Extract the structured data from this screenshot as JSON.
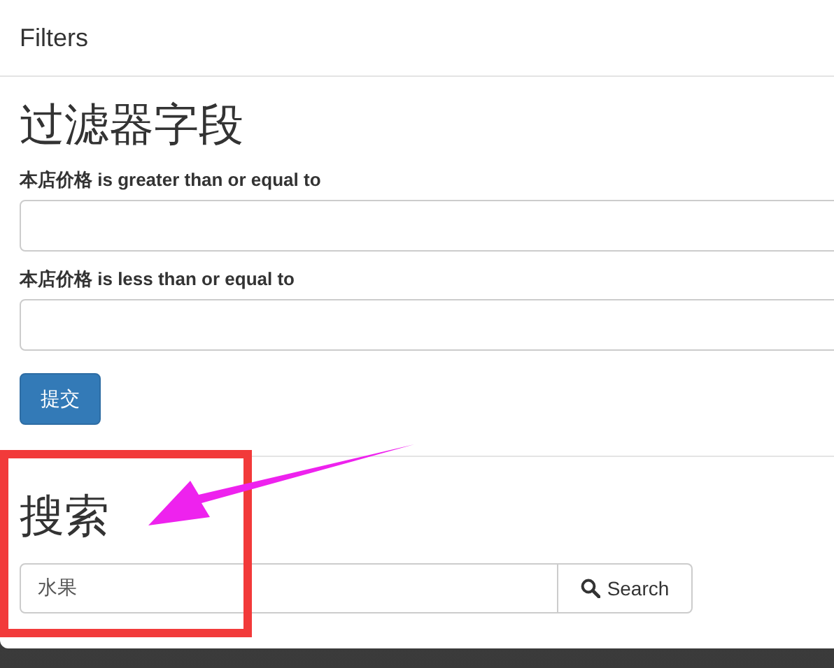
{
  "panel": {
    "title": "Filters"
  },
  "filter_section": {
    "heading": "过滤器字段",
    "fields": [
      {
        "label": "本店价格 is greater than or equal to"
      },
      {
        "label": "本店价格 is less than or equal to"
      }
    ],
    "submit_button": "提交"
  },
  "search_section": {
    "heading": "搜索",
    "value": "水果",
    "button": "Search"
  }
}
